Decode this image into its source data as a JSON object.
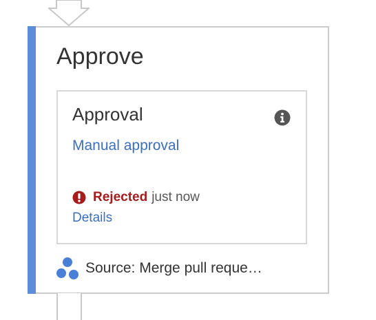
{
  "stage": {
    "title": "Approve"
  },
  "action": {
    "title": "Approval",
    "provider": "Manual approval",
    "status": "Rejected",
    "time": "just now",
    "details_label": "Details"
  },
  "source": {
    "text": "Source: Merge pull reque…"
  },
  "colors": {
    "accent": "#5b8dd9",
    "link": "#3a6fbf",
    "error": "#a61b1b",
    "source_icon": "#4a7fd8"
  },
  "icons": {
    "info": "info-circle-icon",
    "error": "exclamation-circle-icon",
    "source": "git-source-icon",
    "connector": "arrow-down-icon"
  }
}
